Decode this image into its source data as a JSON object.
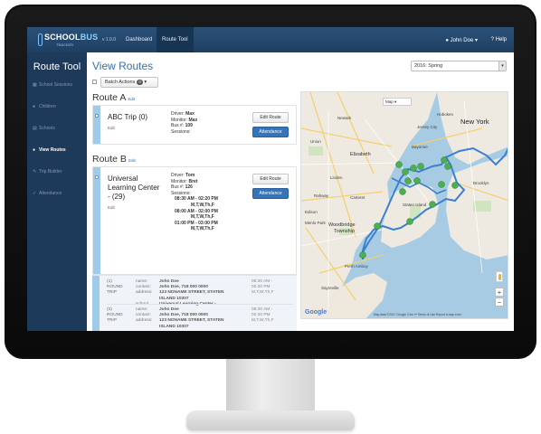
{
  "app": {
    "logo_text_a": "SCHOOL",
    "logo_text_b": "BUS",
    "logo_sub": "TRACKER",
    "version": "v 1.0.0"
  },
  "nav": {
    "dashboard": "Dashboard",
    "route_tool": "Route Tool",
    "user": "John Doe ▾",
    "help": "Help"
  },
  "sidebar": {
    "title": "Route Tool",
    "items": [
      {
        "label": "School Sessions",
        "icon": "calendar-icon",
        "active": false
      },
      {
        "label": "Children",
        "icon": "user-icon",
        "active": false
      },
      {
        "label": "Schools",
        "icon": "building-icon",
        "active": false
      },
      {
        "label": "View Routes",
        "icon": "group-icon",
        "active": true
      },
      {
        "label": "Trip Builder",
        "icon": "wrench-icon",
        "active": false
      },
      {
        "label": "Attendance",
        "icon": "check-icon",
        "active": false
      }
    ]
  },
  "main": {
    "title": "View Routes",
    "season_select": "2016: Spring",
    "batch_actions": "Batch Actions",
    "batch_count": "0"
  },
  "routes": [
    {
      "heading": "Route A",
      "edit": "Edit",
      "card": {
        "name": "ABC Trip (0)",
        "edit": "Edit",
        "driver_label": "Driver:",
        "driver": "Max",
        "monitor_label": "Monitor:",
        "monitor": "Max",
        "bus_label": "Bus #:",
        "bus": "109",
        "sessions_label": "Sessions:",
        "edit_route": "Edit Route",
        "attendance": "Attendance"
      }
    },
    {
      "heading": "Route B",
      "edit": "Edit",
      "card": {
        "name_line1": "Universal",
        "name_line2": "Learning Center",
        "name_line3": "- (29)",
        "edit": "Edit",
        "driver_label": "Driver:",
        "driver": "Tom",
        "monitor_label": "Monitor:",
        "monitor": "Bret",
        "bus_label": "Bus #:",
        "bus": "126",
        "sessions_label": "Sessions:",
        "sessions": [
          {
            "time": "08:30 AM - 02:20 PM",
            "days": "M,T,W,Th,F"
          },
          {
            "time": "08:00 AM - 02:00 PM",
            "days": "M,T,W,Th,F"
          },
          {
            "time": "01:00 PM - 03:00 PM",
            "days": "M,T,W,Th,F"
          }
        ],
        "edit_route": "Edit Route",
        "attendance": "Attendance"
      },
      "stops": [
        {
          "num": "(1)",
          "type1": "ROUND",
          "type2": "TRIP",
          "name_label": "name:",
          "name": "John Doe",
          "contact_label": "contact:",
          "contact": "John Doe, 718 000 0000",
          "address_label": "address:",
          "address1": "123 NONAME STREET, STATEN",
          "address2": "ISLAND 10307",
          "school_label": "school:",
          "school": "Universal Learning Center -",
          "time1": "08:30 AM -",
          "time2": "02:20 PM",
          "days": "M,T,W,Th,F"
        },
        {
          "num": "(2)",
          "type1": "ROUND",
          "type2": "TRIP",
          "name_label": "name:",
          "name": "John Doe",
          "contact_label": "contact:",
          "contact": "John Doe, 718 000 0000",
          "address_label": "address:",
          "address1": "123 NONAME STREET, STATEN",
          "address2": "ISLAND 10307",
          "time1": "08:30 AM -",
          "time2": "02:20 PM",
          "days": "M,T,W,Th,F"
        }
      ]
    }
  ],
  "map": {
    "type_control": "Map",
    "labels": {
      "new_york": "New York",
      "elizabeth": "Elizabeth",
      "woodbridge1": "Woodbridge",
      "woodbridge2": "Township",
      "perth_amboy": "Perth Amboy",
      "newark": "Newark",
      "union": "Union",
      "bayonne": "Bayonne",
      "linden": "Linden",
      "rahway": "Rahway",
      "carteret": "Carteret",
      "staten_island": "Staten Island",
      "sayreville": "Sayreville",
      "hoboken": "Hoboken",
      "jersey_city": "Jersey City",
      "brooklyn": "Brooklyn",
      "edison": "Edison",
      "menlo_park": "Menlo Park"
    },
    "zoom_in": "+",
    "zoom_out": "−",
    "google": "Google",
    "attribution": "Map data ©2017 Google   2 km ⊢   Terms of Use   Report a map error",
    "route_color": "#3a7fd0",
    "marker_color": "#4caf50",
    "water_color": "#a7cbe2",
    "land_color": "#eeeae2"
  }
}
